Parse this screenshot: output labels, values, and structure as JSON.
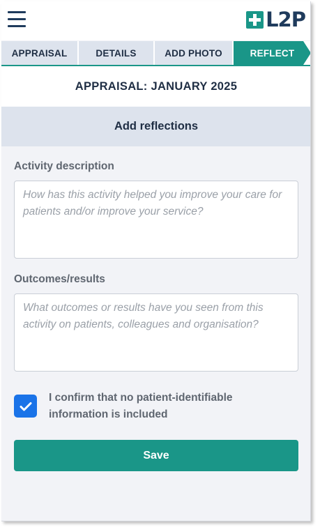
{
  "app": {
    "logo_text": "L2P",
    "brand_color": "#1a9688",
    "navy_color": "#1f3b5c"
  },
  "header": {
    "menu_icon": "hamburger-menu-icon",
    "logo_icon": "medical-cross-icon"
  },
  "tabs": [
    {
      "label": "APPRAISAL",
      "active": false
    },
    {
      "label": "DETAILS",
      "active": false
    },
    {
      "label": "ADD PHOTO",
      "active": false
    },
    {
      "label": "REFLECT",
      "active": true
    }
  ],
  "page": {
    "title": "APPRAISAL: JANUARY 2025",
    "section_title": "Add reflections"
  },
  "fields": {
    "activity_description": {
      "label": "Activity description",
      "value": "",
      "placeholder": "How has this activity helped you improve your care for patients and/or improve your service?"
    },
    "outcomes": {
      "label": "Outcomes/results",
      "value": "",
      "placeholder": "What outcomes or results have you seen from this activity on patients, colleagues and organisation?"
    }
  },
  "confirm": {
    "checked": true,
    "label": "I confirm that no patient-identifiable information is included",
    "icon": "checkmark-icon",
    "color": "#1a73e8"
  },
  "actions": {
    "save_label": "Save"
  }
}
